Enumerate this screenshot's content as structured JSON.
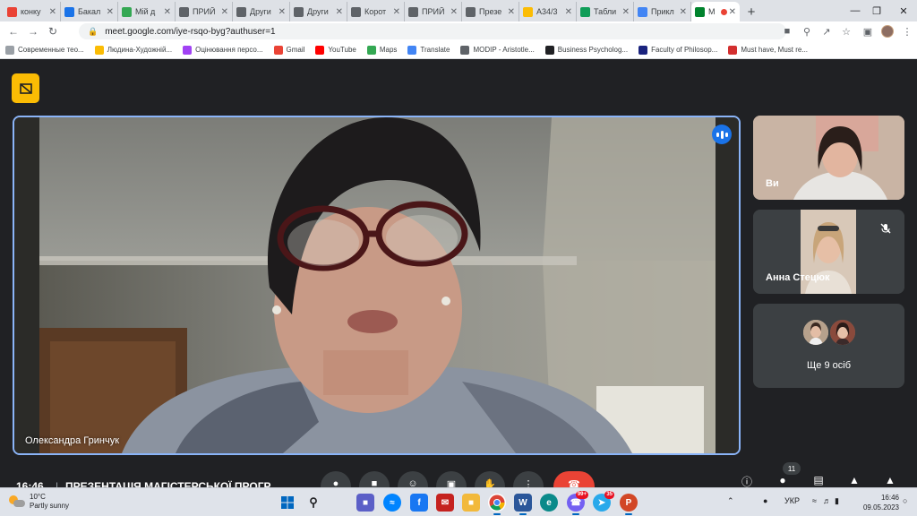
{
  "browser": {
    "tabs": [
      {
        "label": "конку",
        "icon": "gmail-icon",
        "color": "#ea4335"
      },
      {
        "label": "Бакал",
        "icon": "drive-icon",
        "color": "#1a73e8"
      },
      {
        "label": "Мій д",
        "icon": "drive-icon",
        "color": "#34a853"
      },
      {
        "label": "ПРИЙ",
        "icon": "globe-icon",
        "color": "#5f6368"
      },
      {
        "label": "Други",
        "icon": "globe-icon",
        "color": "#5f6368"
      },
      {
        "label": "Други",
        "icon": "globe-icon",
        "color": "#5f6368"
      },
      {
        "label": "Корот",
        "icon": "globe-icon",
        "color": "#5f6368"
      },
      {
        "label": "ПРИЙ",
        "icon": "globe-icon",
        "color": "#5f6368"
      },
      {
        "label": "Презе",
        "icon": "globe-icon",
        "color": "#5f6368"
      },
      {
        "label": "A34/3",
        "icon": "drive-icon",
        "color": "#fbbc04"
      },
      {
        "label": "Табли",
        "icon": "sheets-icon",
        "color": "#0f9d58"
      },
      {
        "label": "Прикл",
        "icon": "calendar-icon",
        "color": "#4285f4"
      },
      {
        "label": "M",
        "icon": "meet-icon",
        "color": "#00832d",
        "active": true
      }
    ],
    "new_tab": "+",
    "url": "meet.google.com/iye-rsqo-byg?authuser=1",
    "bookmarks": [
      {
        "label": "Современные тео...",
        "color": "#9aa0a6"
      },
      {
        "label": "Людина-Художній...",
        "color": "#fbbc04"
      },
      {
        "label": "Оцінювання персо...",
        "color": "#a142f4"
      },
      {
        "label": "Gmail",
        "color": "#ea4335"
      },
      {
        "label": "YouTube",
        "color": "#ff0000"
      },
      {
        "label": "Maps",
        "color": "#34a853"
      },
      {
        "label": "Translate",
        "color": "#4285f4"
      },
      {
        "label": "MODIP - Aristotle...",
        "color": "#5f6368"
      },
      {
        "label": "Business Psycholog...",
        "color": "#202124"
      },
      {
        "label": "Faculty of Philosop...",
        "color": "#1a237e"
      },
      {
        "label": "Must have, Must re...",
        "color": "#d32f2f"
      }
    ]
  },
  "meet": {
    "main_speaker": "Олександра Гринчук",
    "tiles": [
      {
        "label": "Ви"
      },
      {
        "label": "Анна Стецюк"
      }
    ],
    "more_people": "Ще 9 осіб",
    "clock": "16:46",
    "separator": "|",
    "meeting_title": "ПРЕЗЕНТАЦІЯ МАГІСТЕРСЬКОЇ ПРОГР...",
    "participant_count": "11"
  },
  "taskbar": {
    "weather_temp": "10°C",
    "weather_desc": "Partly sunny",
    "language": "УКР",
    "time": "16:46",
    "date": "09.05.2023",
    "badge_messenger": "99+",
    "badge_telegram": "35"
  }
}
